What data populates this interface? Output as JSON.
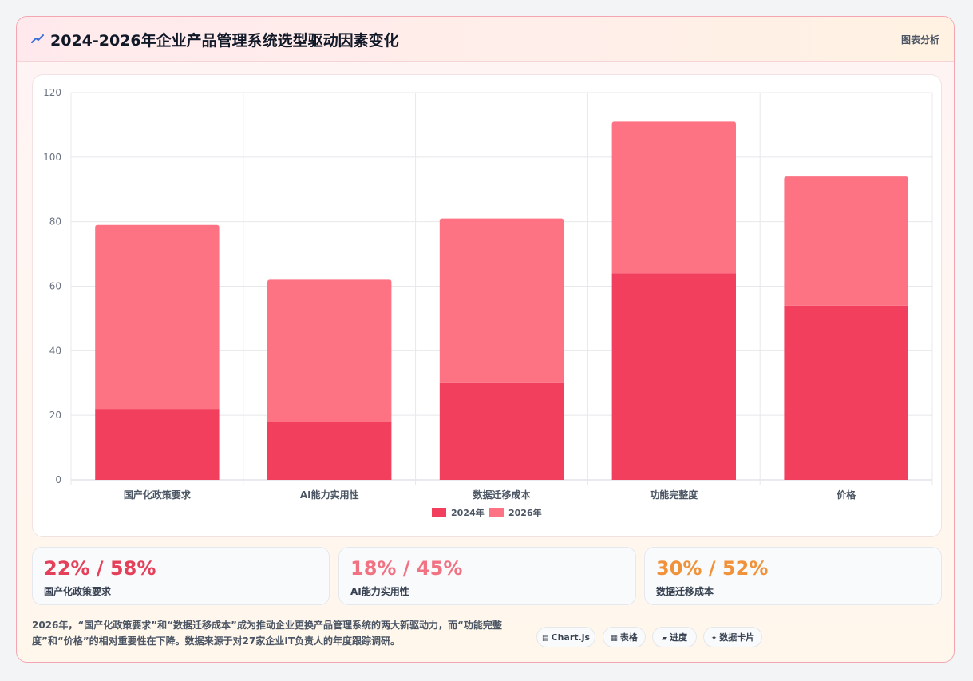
{
  "header": {
    "title": "2024-2026年企业产品管理系统选型驱动因素变化",
    "tag": "图表分析",
    "icon": "trend-line-icon"
  },
  "colors": {
    "series2024": "#f23f5e",
    "series2026": "#fd7384",
    "stat1": "#e5405a",
    "stat2": "#f17282",
    "stat3": "#f0923a"
  },
  "chart_data": {
    "type": "bar",
    "stacked": true,
    "categories": [
      "国产化政策要求",
      "AI能力实用性",
      "数据迁移成本",
      "功能完整度",
      "价格"
    ],
    "series": [
      {
        "name": "2024年",
        "values": [
          22,
          18,
          30,
          64,
          54
        ]
      },
      {
        "name": "2026年",
        "values": [
          57,
          44,
          51,
          47,
          40
        ]
      }
    ],
    "yticks": [
      "0",
      "20",
      "40",
      "60",
      "80",
      "100",
      "120"
    ],
    "ylim": [
      0,
      120
    ],
    "grid": true,
    "legend": "bottom"
  },
  "stats": [
    {
      "value": "22% / 58%",
      "label": "国产化政策要求"
    },
    {
      "value": "18% / 45%",
      "label": "AI能力实用性"
    },
    {
      "value": "30% / 52%",
      "label": "数据迁移成本"
    }
  ],
  "note": "2026年，“国产化政策要求”和“数据迁移成本”成为推动企业更换产品管理系统的两大新驱动力，而“功能完整度”和“价格”的相对重要性在下降。数据来源于对27家企业IT负责人的年度跟踪调研。",
  "chips": [
    {
      "icon": "chart-icon",
      "glyph": "▤",
      "label": "Chart.js"
    },
    {
      "icon": "table-icon",
      "glyph": "▦",
      "label": "表格"
    },
    {
      "icon": "progress-icon",
      "glyph": "▰",
      "label": "进度"
    },
    {
      "icon": "data-card-icon",
      "glyph": "✦",
      "label": "数据卡片"
    }
  ]
}
